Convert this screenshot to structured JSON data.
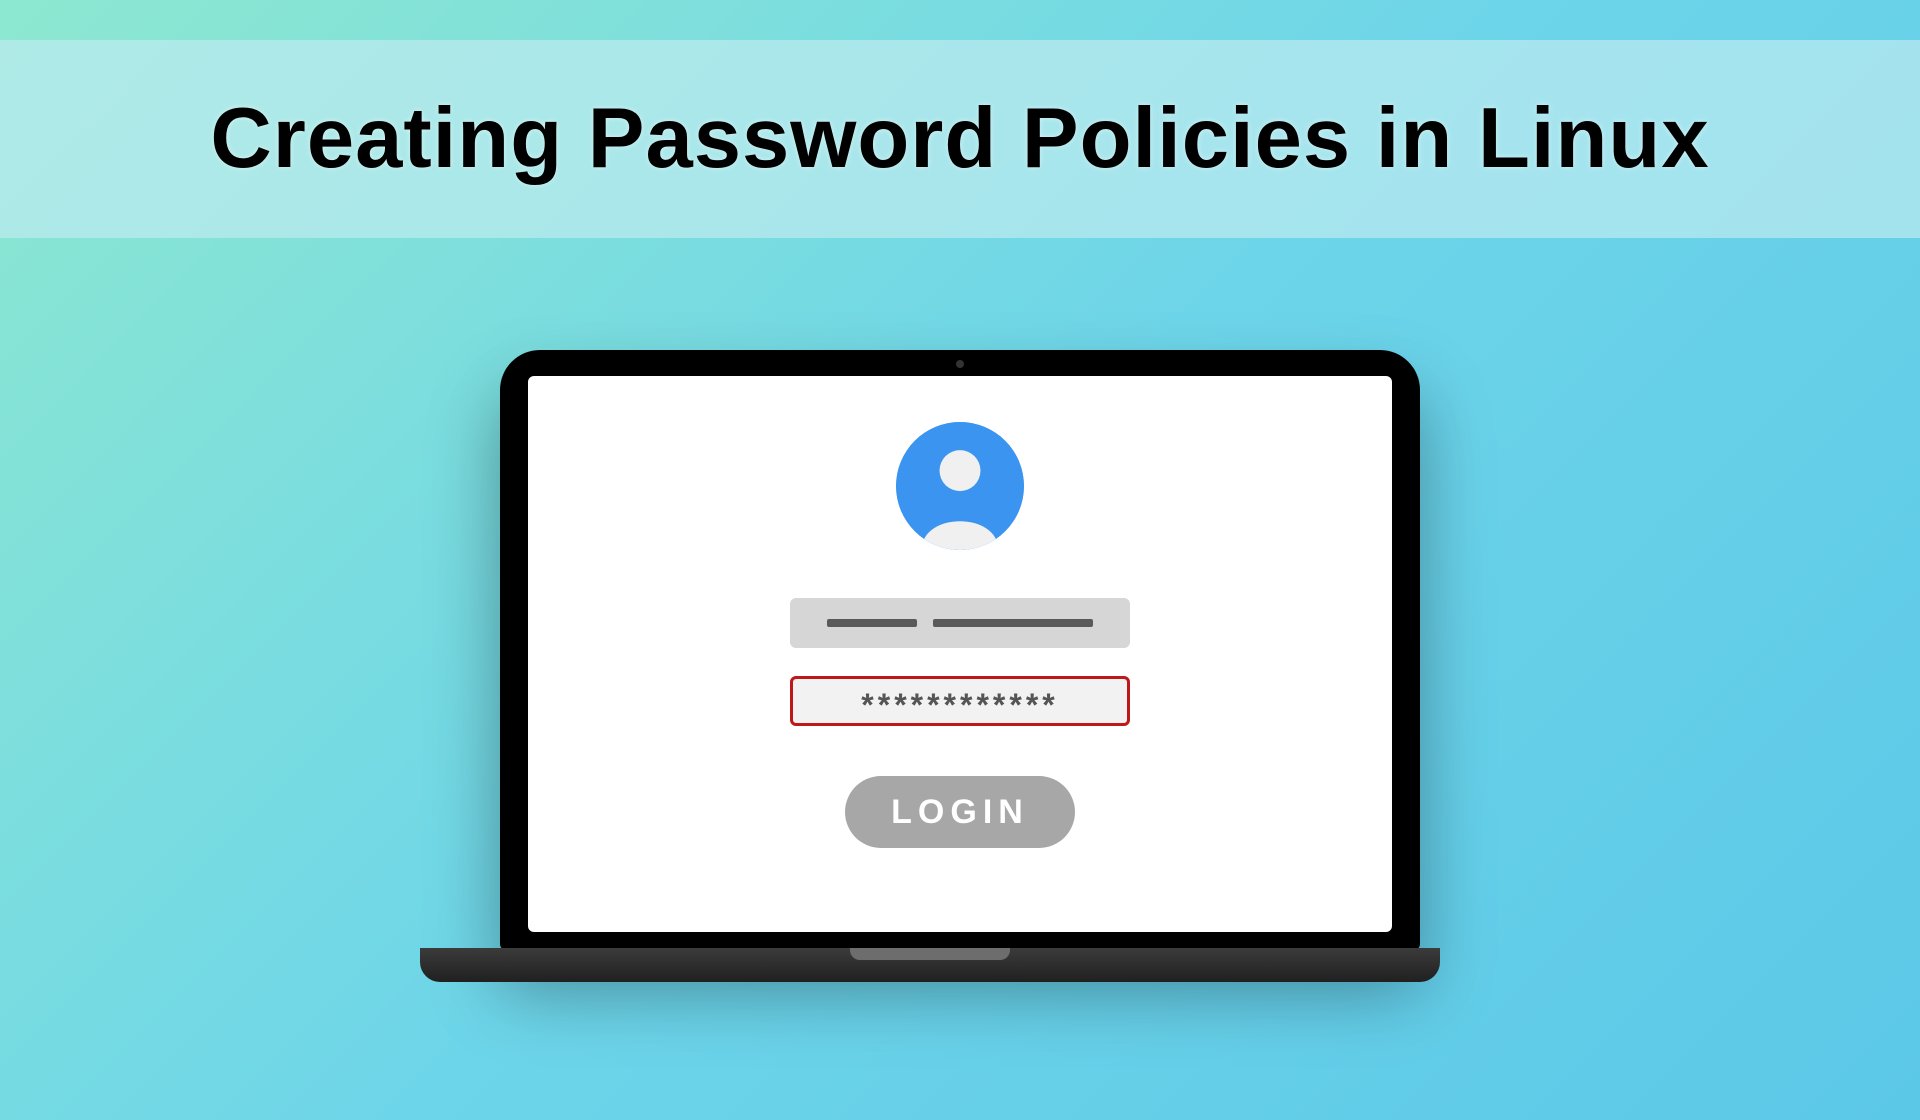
{
  "title": "Creating Password Policies in Linux",
  "login": {
    "password_mask": "************",
    "button_label": "LOGIN"
  },
  "colors": {
    "accent": "#3b94f0",
    "error_border": "#c01818",
    "button_bg": "#a7a7a7"
  }
}
